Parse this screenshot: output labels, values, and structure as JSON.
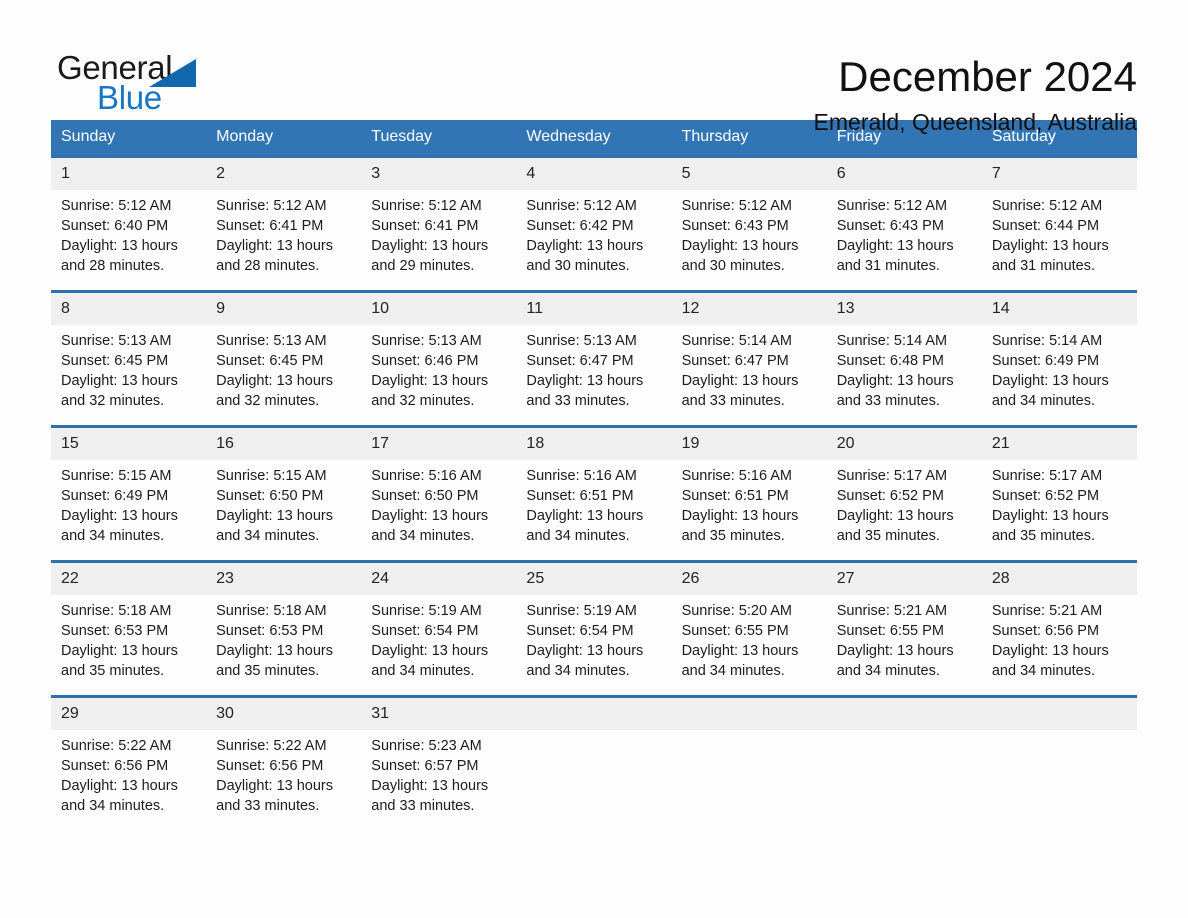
{
  "brand": {
    "name_part1": "General",
    "name_part2": "Blue",
    "logo_icon": "triangle-logo-icon",
    "accent_color": "#1777c4"
  },
  "header": {
    "month_title": "December 2024",
    "location": "Emerald, Queensland, Australia"
  },
  "calendar": {
    "header_bg": "#3275b4",
    "separator_color": "#2f6fae",
    "daynum_bg": "#efefef",
    "weekdays": [
      "Sunday",
      "Monday",
      "Tuesday",
      "Wednesday",
      "Thursday",
      "Friday",
      "Saturday"
    ],
    "weeks": [
      {
        "days": [
          {
            "num": "1",
            "sunrise": "Sunrise: 5:12 AM",
            "sunset": "Sunset: 6:40 PM",
            "daylight1": "Daylight: 13 hours",
            "daylight2": "and 28 minutes."
          },
          {
            "num": "2",
            "sunrise": "Sunrise: 5:12 AM",
            "sunset": "Sunset: 6:41 PM",
            "daylight1": "Daylight: 13 hours",
            "daylight2": "and 28 minutes."
          },
          {
            "num": "3",
            "sunrise": "Sunrise: 5:12 AM",
            "sunset": "Sunset: 6:41 PM",
            "daylight1": "Daylight: 13 hours",
            "daylight2": "and 29 minutes."
          },
          {
            "num": "4",
            "sunrise": "Sunrise: 5:12 AM",
            "sunset": "Sunset: 6:42 PM",
            "daylight1": "Daylight: 13 hours",
            "daylight2": "and 30 minutes."
          },
          {
            "num": "5",
            "sunrise": "Sunrise: 5:12 AM",
            "sunset": "Sunset: 6:43 PM",
            "daylight1": "Daylight: 13 hours",
            "daylight2": "and 30 minutes."
          },
          {
            "num": "6",
            "sunrise": "Sunrise: 5:12 AM",
            "sunset": "Sunset: 6:43 PM",
            "daylight1": "Daylight: 13 hours",
            "daylight2": "and 31 minutes."
          },
          {
            "num": "7",
            "sunrise": "Sunrise: 5:12 AM",
            "sunset": "Sunset: 6:44 PM",
            "daylight1": "Daylight: 13 hours",
            "daylight2": "and 31 minutes."
          }
        ]
      },
      {
        "days": [
          {
            "num": "8",
            "sunrise": "Sunrise: 5:13 AM",
            "sunset": "Sunset: 6:45 PM",
            "daylight1": "Daylight: 13 hours",
            "daylight2": "and 32 minutes."
          },
          {
            "num": "9",
            "sunrise": "Sunrise: 5:13 AM",
            "sunset": "Sunset: 6:45 PM",
            "daylight1": "Daylight: 13 hours",
            "daylight2": "and 32 minutes."
          },
          {
            "num": "10",
            "sunrise": "Sunrise: 5:13 AM",
            "sunset": "Sunset: 6:46 PM",
            "daylight1": "Daylight: 13 hours",
            "daylight2": "and 32 minutes."
          },
          {
            "num": "11",
            "sunrise": "Sunrise: 5:13 AM",
            "sunset": "Sunset: 6:47 PM",
            "daylight1": "Daylight: 13 hours",
            "daylight2": "and 33 minutes."
          },
          {
            "num": "12",
            "sunrise": "Sunrise: 5:14 AM",
            "sunset": "Sunset: 6:47 PM",
            "daylight1": "Daylight: 13 hours",
            "daylight2": "and 33 minutes."
          },
          {
            "num": "13",
            "sunrise": "Sunrise: 5:14 AM",
            "sunset": "Sunset: 6:48 PM",
            "daylight1": "Daylight: 13 hours",
            "daylight2": "and 33 minutes."
          },
          {
            "num": "14",
            "sunrise": "Sunrise: 5:14 AM",
            "sunset": "Sunset: 6:49 PM",
            "daylight1": "Daylight: 13 hours",
            "daylight2": "and 34 minutes."
          }
        ]
      },
      {
        "days": [
          {
            "num": "15",
            "sunrise": "Sunrise: 5:15 AM",
            "sunset": "Sunset: 6:49 PM",
            "daylight1": "Daylight: 13 hours",
            "daylight2": "and 34 minutes."
          },
          {
            "num": "16",
            "sunrise": "Sunrise: 5:15 AM",
            "sunset": "Sunset: 6:50 PM",
            "daylight1": "Daylight: 13 hours",
            "daylight2": "and 34 minutes."
          },
          {
            "num": "17",
            "sunrise": "Sunrise: 5:16 AM",
            "sunset": "Sunset: 6:50 PM",
            "daylight1": "Daylight: 13 hours",
            "daylight2": "and 34 minutes."
          },
          {
            "num": "18",
            "sunrise": "Sunrise: 5:16 AM",
            "sunset": "Sunset: 6:51 PM",
            "daylight1": "Daylight: 13 hours",
            "daylight2": "and 34 minutes."
          },
          {
            "num": "19",
            "sunrise": "Sunrise: 5:16 AM",
            "sunset": "Sunset: 6:51 PM",
            "daylight1": "Daylight: 13 hours",
            "daylight2": "and 35 minutes."
          },
          {
            "num": "20",
            "sunrise": "Sunrise: 5:17 AM",
            "sunset": "Sunset: 6:52 PM",
            "daylight1": "Daylight: 13 hours",
            "daylight2": "and 35 minutes."
          },
          {
            "num": "21",
            "sunrise": "Sunrise: 5:17 AM",
            "sunset": "Sunset: 6:52 PM",
            "daylight1": "Daylight: 13 hours",
            "daylight2": "and 35 minutes."
          }
        ]
      },
      {
        "days": [
          {
            "num": "22",
            "sunrise": "Sunrise: 5:18 AM",
            "sunset": "Sunset: 6:53 PM",
            "daylight1": "Daylight: 13 hours",
            "daylight2": "and 35 minutes."
          },
          {
            "num": "23",
            "sunrise": "Sunrise: 5:18 AM",
            "sunset": "Sunset: 6:53 PM",
            "daylight1": "Daylight: 13 hours",
            "daylight2": "and 35 minutes."
          },
          {
            "num": "24",
            "sunrise": "Sunrise: 5:19 AM",
            "sunset": "Sunset: 6:54 PM",
            "daylight1": "Daylight: 13 hours",
            "daylight2": "and 34 minutes."
          },
          {
            "num": "25",
            "sunrise": "Sunrise: 5:19 AM",
            "sunset": "Sunset: 6:54 PM",
            "daylight1": "Daylight: 13 hours",
            "daylight2": "and 34 minutes."
          },
          {
            "num": "26",
            "sunrise": "Sunrise: 5:20 AM",
            "sunset": "Sunset: 6:55 PM",
            "daylight1": "Daylight: 13 hours",
            "daylight2": "and 34 minutes."
          },
          {
            "num": "27",
            "sunrise": "Sunrise: 5:21 AM",
            "sunset": "Sunset: 6:55 PM",
            "daylight1": "Daylight: 13 hours",
            "daylight2": "and 34 minutes."
          },
          {
            "num": "28",
            "sunrise": "Sunrise: 5:21 AM",
            "sunset": "Sunset: 6:56 PM",
            "daylight1": "Daylight: 13 hours",
            "daylight2": "and 34 minutes."
          }
        ]
      },
      {
        "days": [
          {
            "num": "29",
            "sunrise": "Sunrise: 5:22 AM",
            "sunset": "Sunset: 6:56 PM",
            "daylight1": "Daylight: 13 hours",
            "daylight2": "and 34 minutes."
          },
          {
            "num": "30",
            "sunrise": "Sunrise: 5:22 AM",
            "sunset": "Sunset: 6:56 PM",
            "daylight1": "Daylight: 13 hours",
            "daylight2": "and 33 minutes."
          },
          {
            "num": "31",
            "sunrise": "Sunrise: 5:23 AM",
            "sunset": "Sunset: 6:57 PM",
            "daylight1": "Daylight: 13 hours",
            "daylight2": "and 33 minutes."
          },
          {
            "num": "",
            "sunrise": "",
            "sunset": "",
            "daylight1": "",
            "daylight2": ""
          },
          {
            "num": "",
            "sunrise": "",
            "sunset": "",
            "daylight1": "",
            "daylight2": ""
          },
          {
            "num": "",
            "sunrise": "",
            "sunset": "",
            "daylight1": "",
            "daylight2": ""
          },
          {
            "num": "",
            "sunrise": "",
            "sunset": "",
            "daylight1": "",
            "daylight2": ""
          }
        ]
      }
    ]
  }
}
